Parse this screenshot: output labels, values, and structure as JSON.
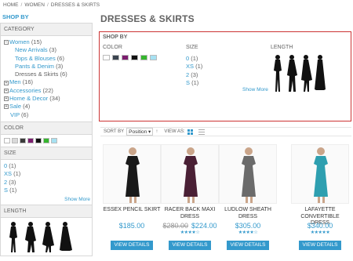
{
  "breadcrumb": {
    "items": [
      "Home",
      "Women",
      "Dresses & Skirts"
    ],
    "sep": "/"
  },
  "sidebar": {
    "title": "Shop By",
    "category": {
      "heading": "Category",
      "items": [
        {
          "label": "Women",
          "count": "(15)",
          "toggle": "−"
        },
        {
          "label": "New Arrivals",
          "count": "(3)"
        },
        {
          "label": "Tops & Blouses",
          "count": "(6)"
        },
        {
          "label": "Pants & Denim",
          "count": "(3)"
        },
        {
          "label": "Dresses & Skirts",
          "count": "(6)"
        },
        {
          "label": "Men",
          "count": "(16)",
          "toggle": "+"
        },
        {
          "label": "Accessories",
          "count": "(22)",
          "toggle": "+"
        },
        {
          "label": "Home & Decor",
          "count": "(34)",
          "toggle": "+"
        },
        {
          "label": "Sale",
          "count": "(4)",
          "toggle": "+"
        },
        {
          "label": "VIP",
          "count": "(6)"
        }
      ]
    },
    "color": {
      "heading": "Color",
      "swatches": [
        "#ffffff",
        "#d9d9d9",
        "#3b3b3b",
        "#7b1d6e",
        "#111111",
        "#35b52e",
        "#a6e1f2"
      ]
    },
    "size": {
      "heading": "Size",
      "options": [
        {
          "label": "0",
          "count": "(1)"
        },
        {
          "label": "XS",
          "count": "(1)"
        },
        {
          "label": "2",
          "count": "(3)"
        },
        {
          "label": "S",
          "count": "(1)"
        }
      ],
      "show_more": "Show More"
    },
    "length": {
      "heading": "Length"
    }
  },
  "main": {
    "title": "Dresses & Skirts",
    "shopby": {
      "title": "Shop By",
      "color_heading": "Color",
      "size_heading": "Size",
      "length_heading": "Length",
      "sizes": [
        {
          "label": "0",
          "count": "(1)"
        },
        {
          "label": "XS",
          "count": "(1)"
        },
        {
          "label": "2",
          "count": "(3)"
        },
        {
          "label": "S",
          "count": "(1)"
        }
      ],
      "show_more": "Show More",
      "swatches": [
        "#ffffff",
        "#3b4450",
        "#7b1d6e",
        "#111111",
        "#35b52e",
        "#a6e1f2"
      ]
    },
    "toolbar": {
      "sort_label": "Sort By",
      "sort_value": "Position",
      "view_label": "View As:"
    },
    "products": [
      {
        "name": "Essex Pencil Skirt",
        "price": "$185.00",
        "old_price": "",
        "stars": "",
        "dress": "#1a1a1a",
        "button": "View Details"
      },
      {
        "name": "Racer Back Maxi Dress",
        "price": "$224.00",
        "old_price": "$280.00",
        "stars": "★★★★☆",
        "dress": "#4a2035",
        "button": "View Details"
      },
      {
        "name": "Ludlow Sheath Dress",
        "price": "$305.00",
        "old_price": "",
        "stars": "★★★★☆",
        "dress": "#6b6b6b",
        "button": "View Details"
      },
      {
        "name": "Lafayette Convertible Dress",
        "price": "$340.00",
        "old_price": "",
        "stars": "★★★★★",
        "dress": "#2e9fb0",
        "button": "View Details"
      }
    ]
  }
}
